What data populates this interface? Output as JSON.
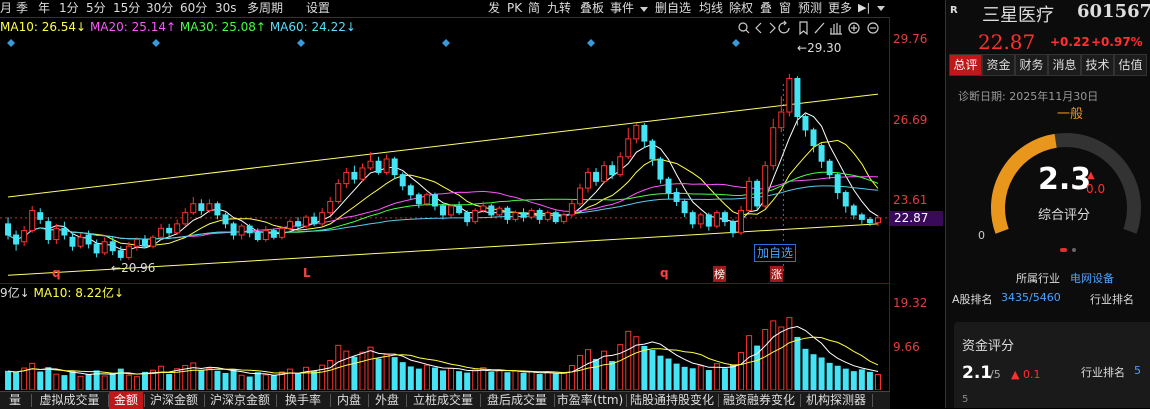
{
  "toolbar": {
    "left_items": [
      "月",
      "季",
      "年",
      "1分",
      "5分",
      "15分",
      "30分",
      "60分",
      "30s",
      "多周期",
      "设置"
    ],
    "right_items": [
      "发",
      "PK",
      "简",
      "九转",
      "叠板",
      "事件",
      "删自选",
      "均线",
      "除权",
      "叠",
      "窗",
      "预测",
      "更多"
    ],
    "icons": [
      "search-icon",
      "back-icon",
      "forward-icon",
      "refresh-icon",
      "bookmark-icon",
      "pencil-icon",
      "hand-icon",
      "zoom-in-icon",
      "zoom-out-icon"
    ]
  },
  "ma": {
    "ma10": "MA10: 26.54",
    "ma20": "MA20: 25.14",
    "ma30": "MA30: 25.08",
    "ma60": "MA60: 24.22"
  },
  "price_axis": [
    "29.76",
    "26.69",
    "23.61",
    "22.87"
  ],
  "annotations": {
    "high": "29.30",
    "low": "20.96",
    "add_watch": "加自选",
    "marker_q1": "q",
    "marker_l": "L",
    "marker_q2": "q",
    "marker_bang": "榜",
    "marker_zhang": "涨"
  },
  "volume": {
    "header_prefix": "9亿↓",
    "ma10": "MA10: 8.22亿↓",
    "axis": [
      "19.32",
      "9.66"
    ]
  },
  "tabs": [
    "量",
    "虚拟成交量",
    "金额",
    "沪深金额",
    "沪深京金额",
    "换手率",
    "内盘",
    "外盘",
    "立桩成交量",
    "盘后成交量",
    "市盈率(ttm)",
    "陆股通持股变化",
    "融资融券变化",
    "机构探测器"
  ],
  "active_tab": "金额",
  "right": {
    "r_label": "R",
    "stock_name": "三星医疗",
    "stock_code": "601567",
    "price": "22.87",
    "change": "+0.22",
    "change_pct": "+0.97%",
    "tabs": [
      "总评",
      "资金",
      "财务",
      "消息",
      "技术",
      "估值"
    ],
    "diag_date": "诊断日期: 2025年11月30日",
    "grade": "一般",
    "score": "2.3",
    "score_delta": "0.0",
    "score_label": "综合评分",
    "gauge_min": "0",
    "gauge_max": "5",
    "score_value": 2.3,
    "industry_label": "所属行业",
    "industry_name": "电网设备",
    "rank_a_label": "A股排名",
    "rank_a_value": "3435/5460",
    "rank_ind_label": "行业排名",
    "fund_title": "资金评分",
    "fund_score": "2.1",
    "fund_total": "/5",
    "fund_delta": "0.1",
    "fund_rank_label": "行业排名",
    "fund_rank_value": "5",
    "fund_min": "5"
  },
  "colors": {
    "up": "#ff3030",
    "down": "#44e4f4",
    "ma5": "#ffffff",
    "ma10": "#ffff44",
    "ma20": "#ff55ff",
    "ma30": "#44ff44",
    "ma60": "#55ccee",
    "gauge": "#e8961c"
  },
  "chart_data": {
    "type": "candlestick",
    "price_range": [
      20.0,
      31.0
    ],
    "marked_high": 29.3,
    "marked_low": 20.96,
    "last": 22.87,
    "candles": [
      [
        22.6,
        22.1,
        22.9,
        21.9
      ],
      [
        22.1,
        21.7,
        22.3,
        21.4
      ],
      [
        21.8,
        22.3,
        22.5,
        21.6
      ],
      [
        22.3,
        23.2,
        23.4,
        22.2
      ],
      [
        23.1,
        22.8,
        23.3,
        22.6
      ],
      [
        22.7,
        21.9,
        22.9,
        21.7
      ],
      [
        21.9,
        22.4,
        22.6,
        21.7
      ],
      [
        22.4,
        22.1,
        22.7,
        21.9
      ],
      [
        22.0,
        21.6,
        22.2,
        21.4
      ],
      [
        21.6,
        22.0,
        22.2,
        21.5
      ],
      [
        22.1,
        21.7,
        22.3,
        21.5
      ],
      [
        21.7,
        21.3,
        21.9,
        21.1
      ],
      [
        21.3,
        21.8,
        22.0,
        21.2
      ],
      [
        21.8,
        21.4,
        22.0,
        21.2
      ],
      [
        21.4,
        21.1,
        21.6,
        20.96
      ],
      [
        21.1,
        21.6,
        21.8,
        21.0
      ],
      [
        21.6,
        21.9,
        22.0,
        21.4
      ],
      [
        21.9,
        21.6,
        22.1,
        21.5
      ],
      [
        21.6,
        22.0,
        22.1,
        21.5
      ],
      [
        22.0,
        22.4,
        22.6,
        21.9
      ],
      [
        22.4,
        22.2,
        22.6,
        22.0
      ],
      [
        22.2,
        22.6,
        22.8,
        22.1
      ],
      [
        22.6,
        23.1,
        23.3,
        22.5
      ],
      [
        23.1,
        23.5,
        23.8,
        23.0
      ],
      [
        23.5,
        23.2,
        23.7,
        23.0
      ],
      [
        23.2,
        23.5,
        23.7,
        23.1
      ],
      [
        23.5,
        23.0,
        23.6,
        22.8
      ],
      [
        23.0,
        22.6,
        23.1,
        22.4
      ],
      [
        22.6,
        22.1,
        22.7,
        21.9
      ],
      [
        22.1,
        22.5,
        22.6,
        21.9
      ],
      [
        22.5,
        22.2,
        22.6,
        22.0
      ],
      [
        22.2,
        21.9,
        22.4,
        21.8
      ],
      [
        21.9,
        22.3,
        22.5,
        21.8
      ],
      [
        22.3,
        22.0,
        22.4,
        21.9
      ],
      [
        22.0,
        22.4,
        22.5,
        21.9
      ],
      [
        22.4,
        22.7,
        22.8,
        22.3
      ],
      [
        22.7,
        22.5,
        22.9,
        22.3
      ],
      [
        22.5,
        22.9,
        23.0,
        22.4
      ],
      [
        22.9,
        22.6,
        23.1,
        22.5
      ],
      [
        22.6,
        23.1,
        23.3,
        22.5
      ],
      [
        23.1,
        23.6,
        23.8,
        23.0
      ],
      [
        23.6,
        24.4,
        24.6,
        23.5
      ],
      [
        24.4,
        24.9,
        25.1,
        24.2
      ],
      [
        24.9,
        24.6,
        25.2,
        24.4
      ],
      [
        24.6,
        25.1,
        25.3,
        24.5
      ],
      [
        25.1,
        25.4,
        25.8,
        25.0
      ],
      [
        25.4,
        24.9,
        25.6,
        24.8
      ],
      [
        24.9,
        25.5,
        25.7,
        24.8
      ],
      [
        25.5,
        24.8,
        25.6,
        24.6
      ],
      [
        24.8,
        24.3,
        24.9,
        24.1
      ],
      [
        24.3,
        23.9,
        24.4,
        23.7
      ],
      [
        23.9,
        23.5,
        24.0,
        23.3
      ],
      [
        23.5,
        23.9,
        24.0,
        23.4
      ],
      [
        23.9,
        23.4,
        24.0,
        23.2
      ],
      [
        23.4,
        23.0,
        23.5,
        22.8
      ],
      [
        23.0,
        23.4,
        23.5,
        22.9
      ],
      [
        23.4,
        23.1,
        23.6,
        23.0
      ],
      [
        23.1,
        22.7,
        23.2,
        22.5
      ],
      [
        22.7,
        23.2,
        23.3,
        22.6
      ],
      [
        23.2,
        23.4,
        23.6,
        23.1
      ],
      [
        23.4,
        23.0,
        23.5,
        22.9
      ],
      [
        23.0,
        23.3,
        23.4,
        22.9
      ],
      [
        23.3,
        22.8,
        23.4,
        22.6
      ],
      [
        22.8,
        23.1,
        23.2,
        22.7
      ],
      [
        23.1,
        22.9,
        23.3,
        22.7
      ],
      [
        22.9,
        23.2,
        23.3,
        22.8
      ],
      [
        23.2,
        22.8,
        23.3,
        22.6
      ],
      [
        22.8,
        23.1,
        23.2,
        22.7
      ],
      [
        23.1,
        22.7,
        23.2,
        22.6
      ],
      [
        22.7,
        23.0,
        23.1,
        22.6
      ],
      [
        23.0,
        23.5,
        23.7,
        22.9
      ],
      [
        23.5,
        24.2,
        24.4,
        23.4
      ],
      [
        24.2,
        24.9,
        25.1,
        24.0
      ],
      [
        24.9,
        24.5,
        25.1,
        24.3
      ],
      [
        24.5,
        25.2,
        25.4,
        24.4
      ],
      [
        25.2,
        24.8,
        25.4,
        24.6
      ],
      [
        24.8,
        25.6,
        25.8,
        24.7
      ],
      [
        25.6,
        26.4,
        26.9,
        25.5
      ],
      [
        26.4,
        27.0,
        27.1,
        26.2
      ],
      [
        27.0,
        26.3,
        27.1,
        26.0
      ],
      [
        26.3,
        25.5,
        26.4,
        25.2
      ],
      [
        25.5,
        24.6,
        25.6,
        24.4
      ],
      [
        24.6,
        24.0,
        24.7,
        23.7
      ],
      [
        24.0,
        23.6,
        24.2,
        23.4
      ],
      [
        23.6,
        23.1,
        23.7,
        22.9
      ],
      [
        23.1,
        22.6,
        23.2,
        22.4
      ],
      [
        22.6,
        23.0,
        23.1,
        22.4
      ],
      [
        23.0,
        22.5,
        23.1,
        22.3
      ],
      [
        22.5,
        23.1,
        23.2,
        22.4
      ],
      [
        23.1,
        22.7,
        23.2,
        22.5
      ],
      [
        22.7,
        22.2,
        22.8,
        22.0
      ],
      [
        22.2,
        23.2,
        23.4,
        22.1
      ],
      [
        23.2,
        24.5,
        24.7,
        23.1
      ],
      [
        24.5,
        23.4,
        24.6,
        23.2
      ],
      [
        23.4,
        25.2,
        25.4,
        23.3
      ],
      [
        25.2,
        26.9,
        27.3,
        25.0
      ],
      [
        26.9,
        27.6,
        28.3,
        26.7
      ],
      [
        27.6,
        29.1,
        29.3,
        27.4
      ],
      [
        29.1,
        27.4,
        29.2,
        27.0
      ],
      [
        27.4,
        26.8,
        27.5,
        26.5
      ],
      [
        26.8,
        26.1,
        26.9,
        25.8
      ],
      [
        26.1,
        25.4,
        26.2,
        25.1
      ],
      [
        25.4,
        24.8,
        25.5,
        24.6
      ],
      [
        24.8,
        24.0,
        24.9,
        23.7
      ],
      [
        24.0,
        23.4,
        24.1,
        23.1
      ],
      [
        23.4,
        23.0,
        23.5,
        22.8
      ],
      [
        23.0,
        22.8,
        23.1,
        22.6
      ],
      [
        22.8,
        22.65,
        22.9,
        22.5
      ],
      [
        22.65,
        22.87,
        23.0,
        22.5
      ]
    ],
    "volume_range": [
      0,
      25.0
    ],
    "volumes": [
      5.2,
      4.8,
      6.1,
      7.4,
      5.0,
      6.2,
      4.4,
      4.0,
      5.1,
      3.8,
      4.2,
      5.3,
      3.9,
      4.6,
      5.8,
      4.1,
      3.7,
      4.9,
      5.5,
      6.6,
      4.3,
      5.9,
      6.8,
      7.5,
      5.4,
      6.0,
      5.2,
      4.6,
      5.7,
      4.1,
      3.6,
      4.8,
      4.2,
      3.9,
      5.0,
      5.8,
      4.4,
      6.3,
      5.1,
      6.9,
      8.2,
      12.4,
      10.8,
      9.1,
      10.5,
      11.9,
      8.6,
      9.9,
      9.0,
      7.6,
      6.4,
      5.8,
      6.9,
      6.1,
      5.3,
      6.0,
      5.1,
      4.7,
      5.6,
      6.2,
      4.9,
      5.5,
      4.8,
      5.3,
      4.6,
      5.0,
      4.3,
      4.9,
      4.4,
      4.7,
      6.8,
      9.6,
      11.2,
      8.5,
      10.8,
      7.9,
      12.6,
      16.3,
      14.8,
      12.1,
      11.0,
      9.4,
      8.6,
      7.2,
      6.3,
      5.9,
      6.7,
      5.4,
      7.3,
      5.9,
      6.8,
      10.4,
      15.1,
      12.2,
      16.8,
      19.2,
      17.5,
      20.1,
      14.6,
      11.3,
      9.8,
      8.9,
      7.4,
      6.6,
      5.8,
      5.1,
      5.6,
      4.9,
      4.3
    ],
    "trend_lines": [
      {
        "from": [
          0,
          23.8
        ],
        "to": [
          108,
          28.4
        ]
      },
      {
        "from": [
          0,
          20.3
        ],
        "to": [
          108,
          22.6
        ]
      }
    ],
    "diamond_markers": [
      0,
      18,
      36,
      54,
      72,
      90
    ]
  }
}
